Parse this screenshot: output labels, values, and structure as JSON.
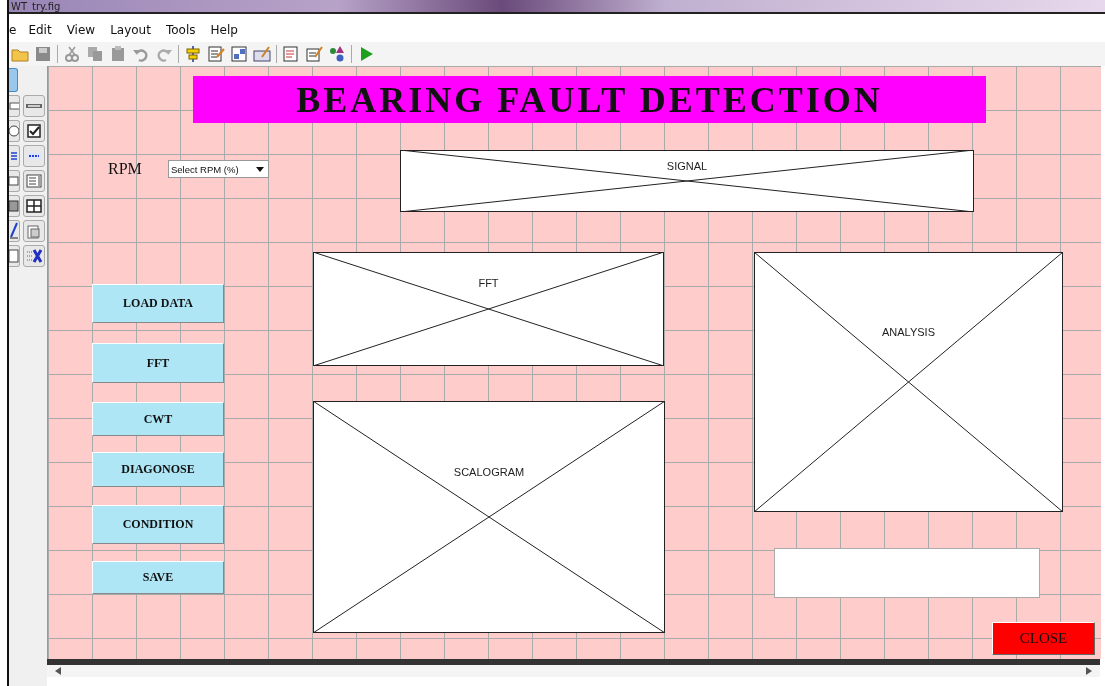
{
  "window": {
    "title": "WT_try.fig"
  },
  "menu": [
    "e",
    "Edit",
    "View",
    "Layout",
    "Tools",
    "Help"
  ],
  "canvas": {
    "title_banner": "BEARING FAULT DETECTION",
    "rpm_label": "RPM",
    "rpm_popup": {
      "value": "Select RPM (%)"
    },
    "axes": [
      {
        "label": "SIGNAL"
      },
      {
        "label": "FFT"
      },
      {
        "label": "SCALOGRAM"
      },
      {
        "label": "ANALYSIS"
      }
    ],
    "buttons": [
      {
        "label": "LOAD DATA"
      },
      {
        "label": "FFT"
      },
      {
        "label": "CWT"
      },
      {
        "label": "DIAGONOSE"
      },
      {
        "label": "CONDITION"
      },
      {
        "label": "SAVE"
      }
    ],
    "close_button": {
      "label": "CLOSE"
    }
  }
}
